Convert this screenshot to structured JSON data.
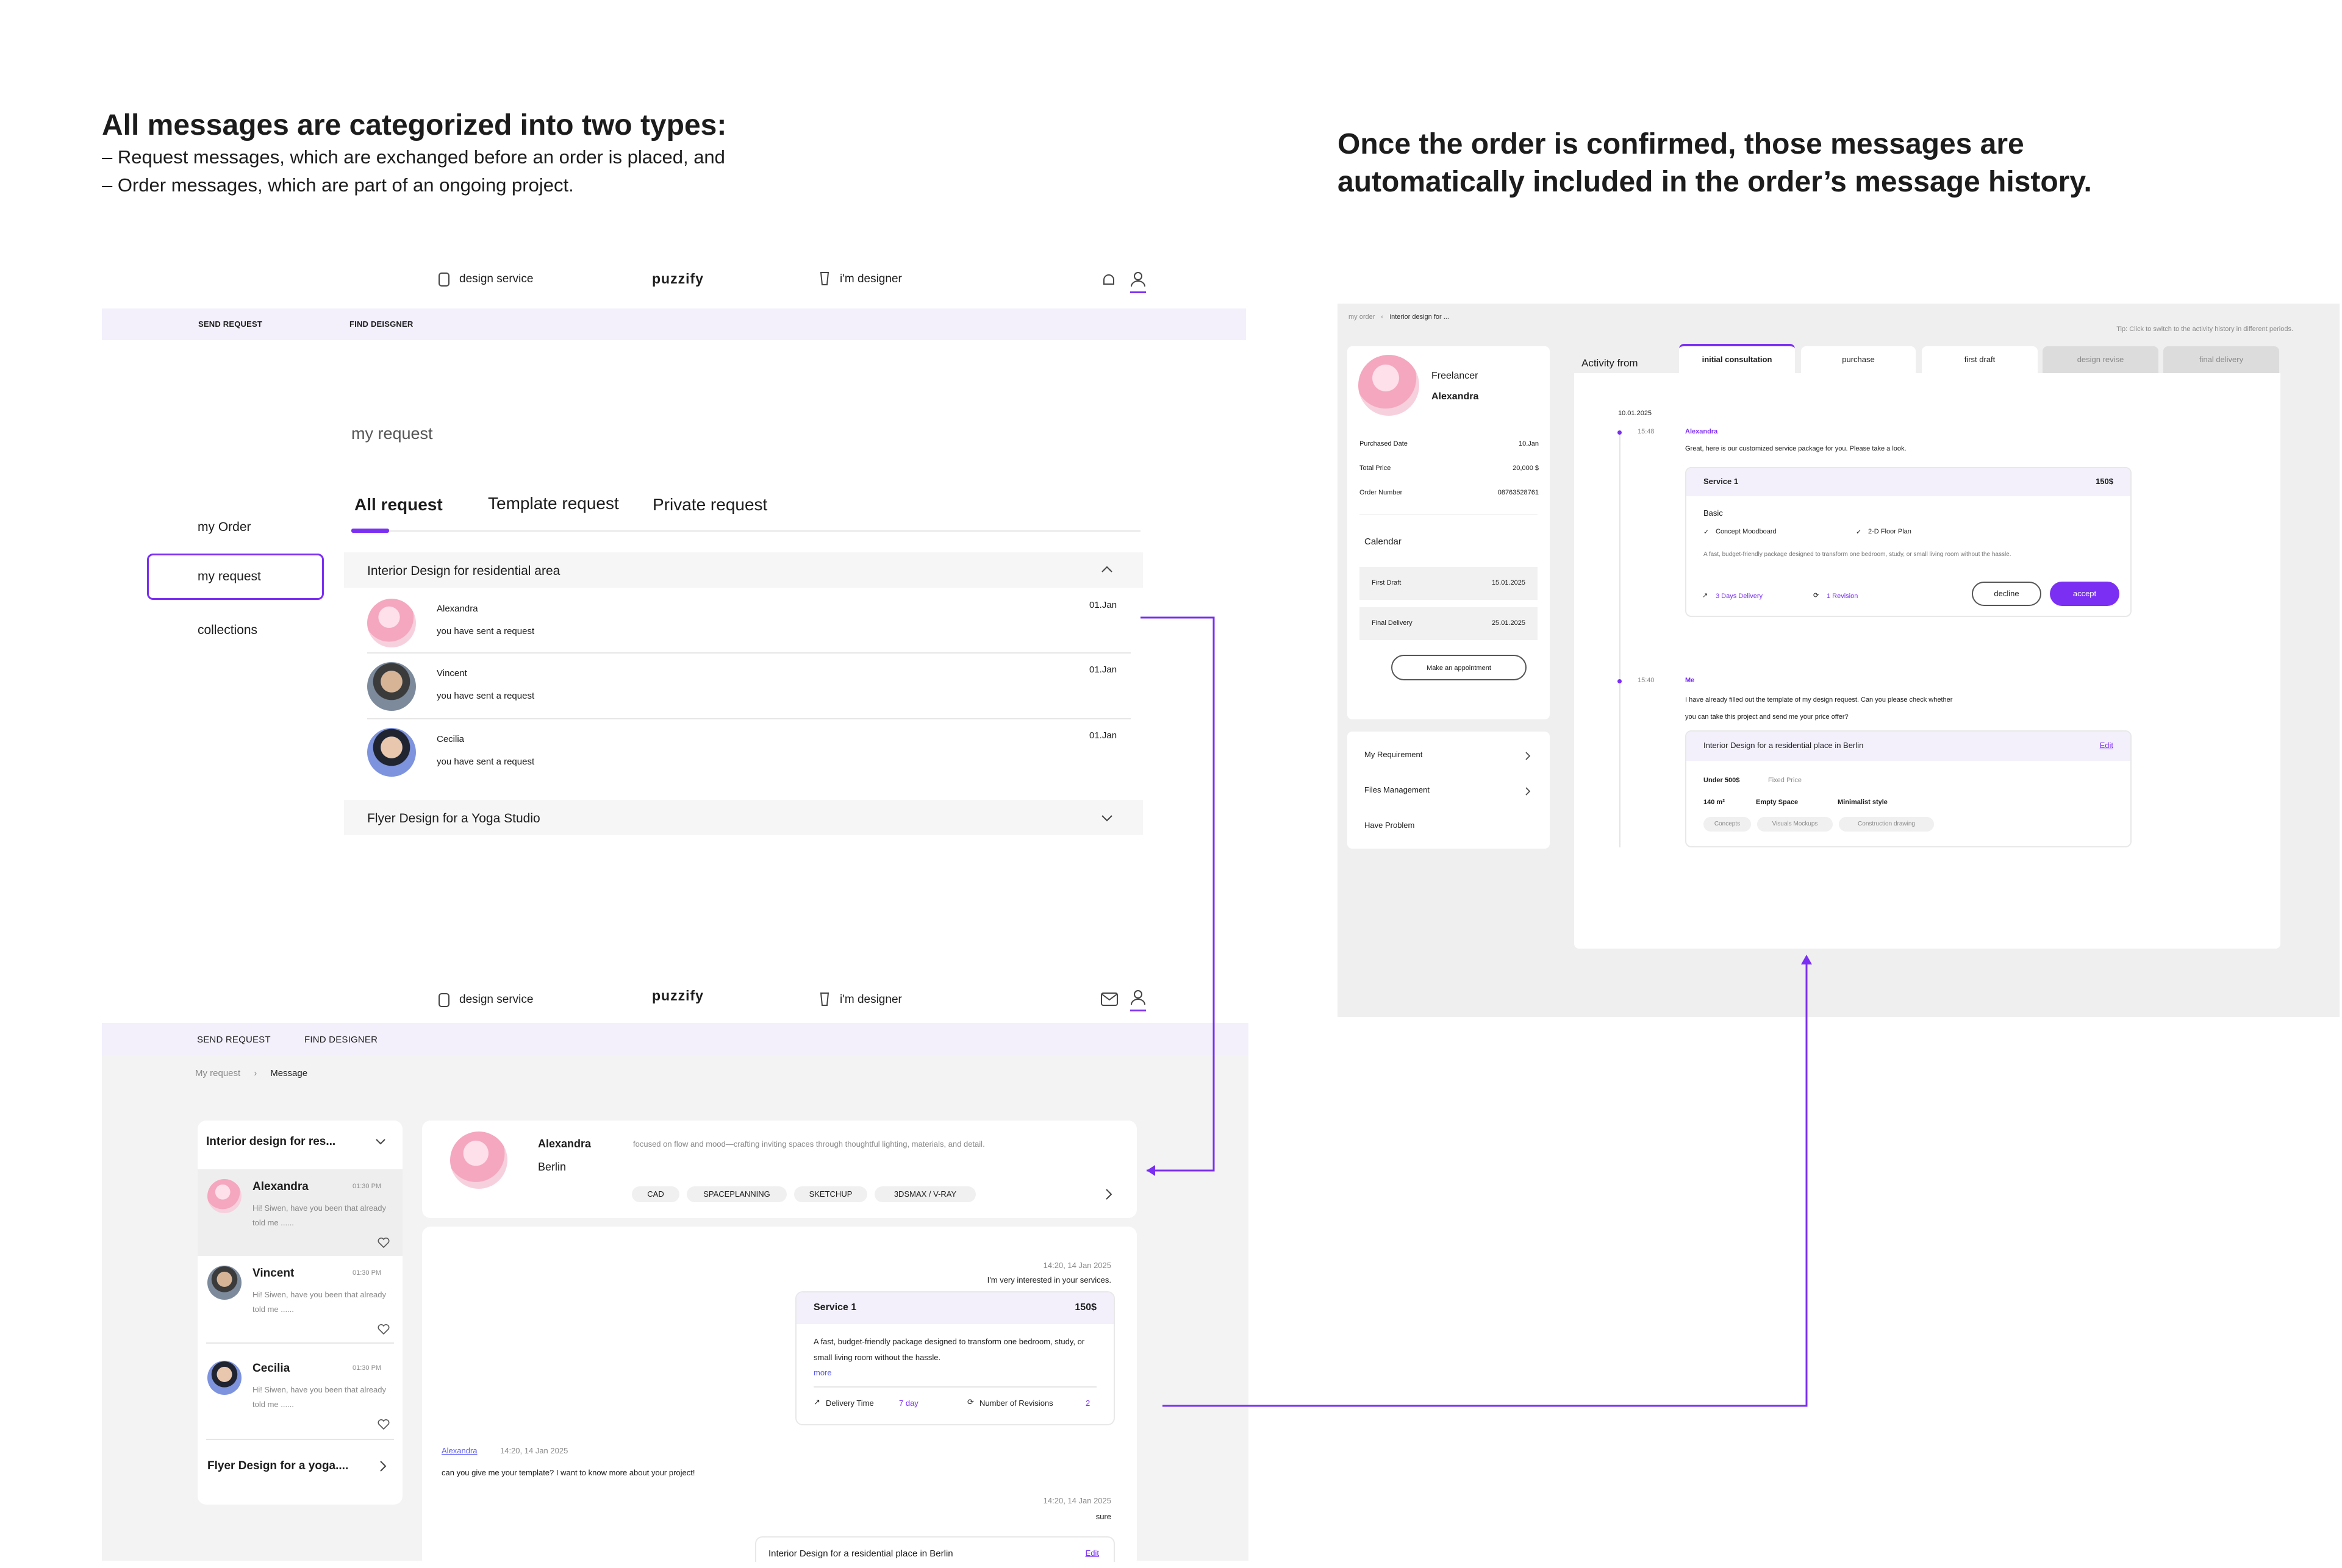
{
  "intro": {
    "title": "All messages are categorized into two types:",
    "line1": "– Request messages, which are exchanged before an order is placed, and",
    "line2": "– Order messages, which are part of an ongoing project."
  },
  "right_intro": {
    "line1": "Once the order is confirmed, those messages are",
    "line2": "automatically included in the order’s message history."
  },
  "topnav": {
    "design_service": "design service",
    "logo": "puzzify",
    "im_designer": "i'm designer"
  },
  "bar": {
    "send_request": "SEND REQUEST",
    "find_designer": "FIND DEISGNER",
    "find_designer_2": "FIND DESIGNER"
  },
  "request_page": {
    "heading": "my request",
    "sidebar": [
      "my Order",
      "my request",
      "collections"
    ],
    "tabs": [
      "All request",
      "Template request",
      "Private request"
    ],
    "group1": "Interior Design for residential area",
    "rows": [
      {
        "name": "Alexandra",
        "msg": "you have sent a request",
        "date": "01.Jan"
      },
      {
        "name": "Vincent",
        "msg": "you have sent a request",
        "date": "01.Jan"
      },
      {
        "name": "Cecilia",
        "msg": "you have sent a request",
        "date": "01.Jan"
      }
    ],
    "group2": "Flyer Design for a Yoga Studio"
  },
  "message_page": {
    "breadcrumb": [
      "My request",
      "Message"
    ],
    "list_title": "Interior design for res...",
    "conversations": [
      {
        "name": "Alexandra",
        "time": "01:30 PM",
        "preview": "Hi! Siwen, have you been that already told me ......"
      },
      {
        "name": "Vincent",
        "time": "01:30 PM",
        "preview": "Hi! Siwen, have you been that already told me ......"
      },
      {
        "name": "Cecilia",
        "time": "01:30 PM",
        "preview": "Hi! Siwen, have you been that already told me ......"
      }
    ],
    "list_footer": "Flyer Design for a yoga....",
    "profile": {
      "name": "Alexandra",
      "city": "Berlin",
      "bio": "focused on flow and mood—crafting inviting spaces through thoughtful lighting, materials, and detail.",
      "skills": [
        "CAD",
        "SPACEPLANNING",
        "SKETCHUP",
        "3DSMAX / V-RAY"
      ]
    },
    "m1": {
      "time": "14:20, 14 Jan 2025",
      "text": "I'm very interested in your services."
    },
    "service": {
      "title": "Service 1",
      "price": "150$",
      "desc": "A fast, budget-friendly package designed to transform one bedroom, study, or small living room without the hassle.",
      "more": "more",
      "delivery_label": "Delivery Time",
      "delivery_val": "7 day",
      "rev_label": "Number of Revisions",
      "rev_val": "2"
    },
    "m2": {
      "sender": "Alexandra",
      "time": "14:20, 14 Jan 2025",
      "text": "can you give me your template? I want to know more about your project!"
    },
    "m3": {
      "time": "14:20, 14 Jan 2025",
      "text": "sure"
    },
    "template_card": {
      "title": "Interior Design for a residential place in Berlin",
      "edit": "Edit"
    }
  },
  "order_page": {
    "breadcrumb": [
      "my order",
      "Interior design for ..."
    ],
    "tip": "Tip: Click to switch to the activity history in different periods.",
    "freelancer_label": "Freelancer",
    "freelancer_name": "Alexandra",
    "info": [
      {
        "label": "Purchased Date",
        "value": "10.Jan"
      },
      {
        "label": "Total Price",
        "value": "20,000 $"
      },
      {
        "label": "Order Number",
        "value": "08763528761"
      }
    ],
    "calendar_title": "Calendar",
    "calendar": [
      {
        "label": "First Draft",
        "value": "15.01.2025"
      },
      {
        "label": "Final Delivery",
        "value": "25.01.2025"
      }
    ],
    "appointment": "Make an appointment",
    "menu": [
      "My Requirement",
      "Files Management",
      "Have Problem"
    ],
    "activity_label": "Activity  from",
    "tabs": [
      "initial consultation",
      "purchase",
      "first draft",
      "design revise",
      "final delivery"
    ],
    "date": "10.01.2025",
    "msg1": {
      "time": "15:48",
      "sender": "Alexandra",
      "text": "Great, here is our customized service package for you. Please take a look."
    },
    "service": {
      "title": "Service 1",
      "price": "150$",
      "tier": "Basic",
      "f1": "Concept Moodboard",
      "f2": "2-D Floor Plan",
      "desc": "A fast, budget-friendly package designed to transform one bedroom, study, or small living room without the hassle.",
      "delivery": "3 Days Delivery",
      "revision": "1 Revision",
      "decline": "decline",
      "accept": "accept"
    },
    "msg2": {
      "time": "15:40",
      "sender": "Me",
      "text1": "I have already filled out the template of my design request. Can you please check whether",
      "text2": "you can take this project and send me your price offer?"
    },
    "template": {
      "title": "Interior Design for a residential place in Berlin",
      "edit": "Edit",
      "budget": "Under 500$",
      "fixed": "Fixed Price",
      "area": "140 m²",
      "space": "Empty Space",
      "style": "Minimalist style",
      "tags": [
        "Concepts",
        "Visuals Mockups",
        "Construction drawing"
      ]
    }
  },
  "colors": {
    "accent": "#7b2ff2",
    "bar": "#f3f0fc",
    "panel_bg": "#efefef"
  }
}
